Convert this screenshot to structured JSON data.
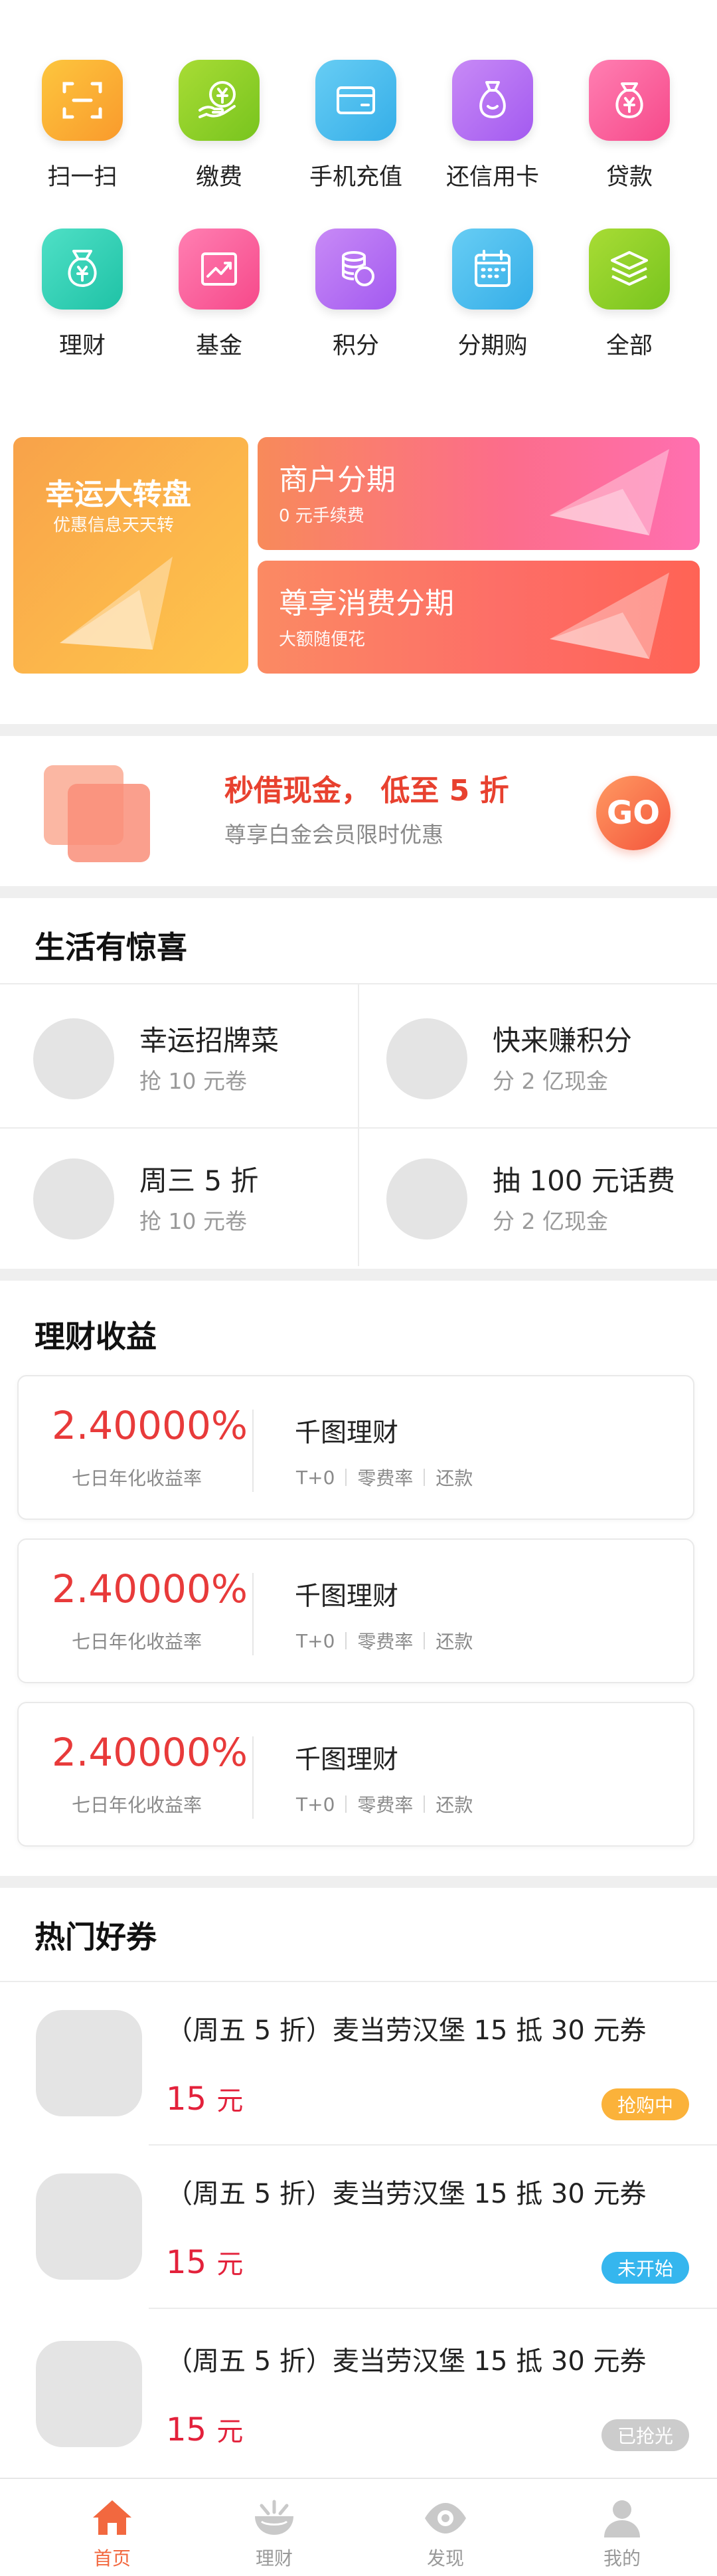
{
  "grid": [
    {
      "label": "扫一扫",
      "icon": "scan-icon",
      "color": "#fbb034"
    },
    {
      "label": "缴费",
      "icon": "payment-icon",
      "color": "#8fd02a"
    },
    {
      "label": "手机充值",
      "icon": "card-icon",
      "color": "#4bbcee"
    },
    {
      "label": "还信用卡",
      "icon": "money-bag-icon",
      "color": "#b56ef3"
    },
    {
      "label": "贷款",
      "icon": "yuan-bag-icon",
      "color": "#fb5f9c"
    },
    {
      "label": "理财",
      "icon": "yuan-pouch-icon",
      "color": "#2ed1b7"
    },
    {
      "label": "基金",
      "icon": "trend-chart-icon",
      "color": "#fb5f9c"
    },
    {
      "label": "积分",
      "icon": "coin-stack-icon",
      "color": "#b56ef3"
    },
    {
      "label": "分期购",
      "icon": "calendar-icon",
      "color": "#4bbcee"
    },
    {
      "label": "全部",
      "icon": "layers-icon",
      "color": "#8fd02a"
    }
  ],
  "promo": {
    "left": {
      "title": "幸运大转盘",
      "sub": "优惠信息天天转"
    },
    "right_top": {
      "title": "商户分期",
      "sub": "0 元手续费"
    },
    "right_bottom": {
      "title": "尊享消费分期",
      "sub": "大额随便花"
    }
  },
  "cash": {
    "title": "秒借现金， 低至 5 折",
    "sub": "尊享白金会员限时优惠",
    "go": "GO"
  },
  "life": {
    "title": "生活有惊喜",
    "items": [
      {
        "name": "幸运招牌菜",
        "sub": "抢 10 元卷"
      },
      {
        "name": "快来赚积分",
        "sub": "分 2 亿现金"
      },
      {
        "name": "周三 5 折",
        "sub": "抢 10 元卷"
      },
      {
        "name": "抽 100 元话费",
        "sub": "分 2 亿现金"
      }
    ]
  },
  "finance": {
    "title": "理财收益",
    "cards": [
      {
        "rate": "2.40000%",
        "rate_label": "七日年化收益率",
        "name": "千图理财",
        "tags": [
          "T+0",
          "零费率",
          "还款"
        ]
      },
      {
        "rate": "2.40000%",
        "rate_label": "七日年化收益率",
        "name": "千图理财",
        "tags": [
          "T+0",
          "零费率",
          "还款"
        ]
      },
      {
        "rate": "2.40000%",
        "rate_label": "七日年化收益率",
        "name": "千图理财",
        "tags": [
          "T+0",
          "零费率",
          "还款"
        ]
      }
    ]
  },
  "coupons": {
    "title": "热门好券",
    "items": [
      {
        "title": "（周五 5 折）麦当劳汉堡 15 抵 30 元券",
        "price": "15",
        "unit": "元",
        "status": "抢购中",
        "status_color": "#fbb23a"
      },
      {
        "title": "（周五 5 折）麦当劳汉堡 15 抵 30 元券",
        "price": "15",
        "unit": "元",
        "status": "未开始",
        "status_color": "#35b6ee"
      },
      {
        "title": "（周五 5 折）麦当劳汉堡 15 抵 30 元券",
        "price": "15",
        "unit": "元",
        "status": "已抢光",
        "status_color": "#cccccc"
      }
    ]
  },
  "tabs": [
    {
      "label": "首页",
      "icon": "home-icon",
      "active": true
    },
    {
      "label": "理财",
      "icon": "finance-bowl-icon",
      "active": false
    },
    {
      "label": "发现",
      "icon": "eye-icon",
      "active": false
    },
    {
      "label": "我的",
      "icon": "user-icon",
      "active": false
    }
  ]
}
